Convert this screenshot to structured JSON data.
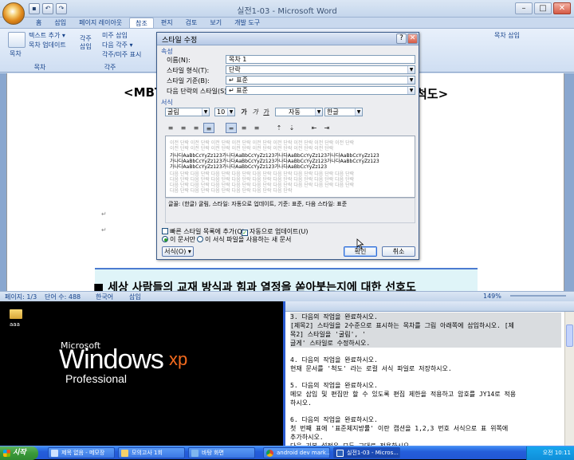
{
  "word": {
    "title": "실전1-03 - Microsoft Word",
    "tabs": [
      "홈",
      "삽입",
      "페이지 레이아웃",
      "참조",
      "편지",
      "검토",
      "보기",
      "개발 도구"
    ],
    "active_tab": "참조",
    "ribbon": {
      "toc_label": "목차",
      "add_text": "텍스트 추가 ▾",
      "update_toc": "목차 업데이트",
      "group_toc": "목차",
      "footnote_insert": "각주\n삽입",
      "next_footnote": "다음 각주 ▾",
      "show_notes": "각주/미주 표시",
      "group_footnote": "각주",
      "endnote_insert": "미주 삽입",
      "right_toc_insert": "목차 삽입"
    },
    "doc": {
      "heading_left": "<MBT",
      "heading_right": "척도>",
      "body_line": "세상 사람들의 교재 방식과 힘과 열정을 쏟아붓는지에 대한 선호도"
    },
    "status": {
      "page": "페이지: 1/3",
      "words": "단어 수: 488",
      "lang": "한국어",
      "mode": "삽입",
      "zoom": "149%"
    }
  },
  "dialog": {
    "title": "스타일 수정",
    "section_props": "속성",
    "name_label": "이름(N):",
    "name_value": "목차 1",
    "type_label": "스타일 형식(T):",
    "type_value": "단락",
    "based_label": "스타일 기준(B):",
    "based_value": "↵ 표준",
    "next_label": "다음 단락의 스타일(S):",
    "next_value": "↵ 표준",
    "section_format": "서식",
    "font": "굴림",
    "size": "10",
    "bold": "가",
    "italic": "가",
    "underline": "가",
    "color": "자동",
    "lang": "한글",
    "preview_prev": [
      "이전 단락 이전 단락 이전 단락 이전 단락 이전 단락 이전 단락 이전 단락 이전 단락 이전 단락",
      "이전 단락 이전 단락 이전 단락 이전 단락 이전 단락 이전 단락 이전 단락 이전 단락"
    ],
    "preview_main": [
      "가나다AaBbCcYyZz123가나다AaBbCcYyZz123가나다AaBbCcYyZz123가나다AaBbCcYyZz123",
      "가나다AaBbCcYyZz123가나다AaBbCcYyZz123가나다AaBbCcYyZz123가나다AaBbCcYyZz123",
      "가나다AaBbCcYyZz123가나다AaBbCcYyZz123가나다AaBbCcYyZz123"
    ],
    "preview_next": [
      "다음 단락 다음 단락 다음 단락 다음 단락 다음 단락 다음 단락 다음 단락 다음 단락 다음 단락",
      "다음 단락 다음 단락 다음 단락 다음 단락 다음 단락 다음 단락 다음 단락 다음 단락 다음 단락",
      "다음 단락 다음 단락 다음 단락 다음 단락 다음 단락 다음 단락 다음 단락 다음 단락 다음 단락",
      "다음 단락 다음 단락 다음 단락 다음 단락 다음 단락 다음 단락"
    ],
    "description": "글꼴: (한글) 굴림, 스타일: 자동으로 업데이트, 기준: 표준, 다음 스타일: 표준",
    "quick_style": "빠른 스타일 목록에 추가(Q)",
    "auto_update": "자동으로 업데이트(U)",
    "this_doc": "이 문서만",
    "new_docs": "이 서식 파일을 사용하는 새 문서",
    "format_btn": "서식(O) ▾",
    "ok": "확인",
    "cancel": "취소"
  },
  "desktop": {
    "icon_label": "aaa",
    "logo_ms": "Microsoft",
    "logo_windows": "Windows",
    "logo_xp": "xp",
    "logo_pro": "Professional"
  },
  "notepad": {
    "blocks": [
      [
        "3. 다음의 작업을 완료하시오.",
        "   [제목2] 스타일을 2수준으로 표시하는 목차를 그림 아래쪽에 삽입하시오. [제",
        "목2] 스타일을 '굴림', '",
        "   글게' 스타일로 수정하시오."
      ],
      [
        "4. 다음의 작업을 완료하시오.",
        "   현재 문서를 '척도' 라는 로컬 서식 파일로 저장하시오."
      ],
      [
        "5. 다음의 작업을 완료하시오.",
        "   메모 삽입 및 편집만 할 수 있도록 편집 제한을 적용하고 암호를 JY14로 적용",
        "하시오."
      ],
      [
        "6. 다음의 작업을 완료하시오.",
        "   첫 번째 표에 '표준체지방률' 이란 캡션을 1,2,3 번호 서식으로 표 위쪽에",
        "추가하시오.",
        "   다음 기본 설정은 모두 그대로 적용하시오."
      ]
    ]
  },
  "taskbar": {
    "start": "시작",
    "items": [
      "제목 없음 - 메모장",
      "모의고사 1회",
      "바탕 화면",
      "android dev mark...",
      "실전1-03 - Micros..."
    ],
    "clock": "오전 10:11"
  }
}
